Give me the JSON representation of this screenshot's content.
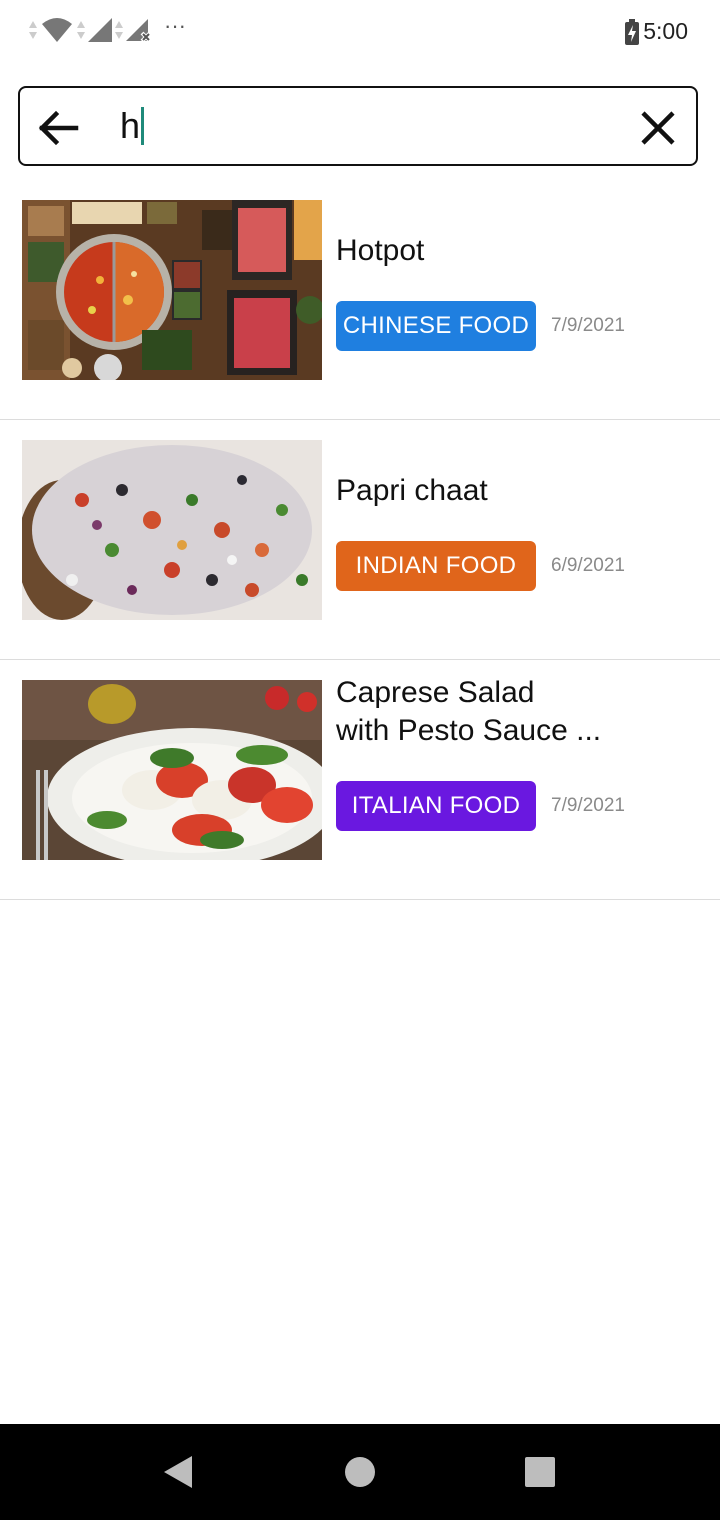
{
  "status_bar": {
    "time": "5:00",
    "more_indicator": "···"
  },
  "search": {
    "query": "h"
  },
  "results": [
    {
      "title": "Hotpot",
      "category": "CHINESE FOOD",
      "category_color": "#1f7fe0",
      "date": "7/9/2021",
      "image": "hotpot-image"
    },
    {
      "title": "Papri chaat",
      "category": "INDIAN FOOD",
      "category_color": "#e0651b",
      "date": "6/9/2021",
      "image": "papri-chaat-image"
    },
    {
      "title": "Caprese Salad\nwith Pesto Sauce ...",
      "category": "ITALIAN FOOD",
      "category_color": "#6a18e0",
      "date": "7/9/2021",
      "image": "caprese-salad-image"
    }
  ],
  "icons": {
    "back": "arrow-left-icon",
    "clear": "close-icon",
    "nav_back": "triangle-back-icon",
    "nav_home": "circle-home-icon",
    "nav_recents": "square-recents-icon"
  }
}
